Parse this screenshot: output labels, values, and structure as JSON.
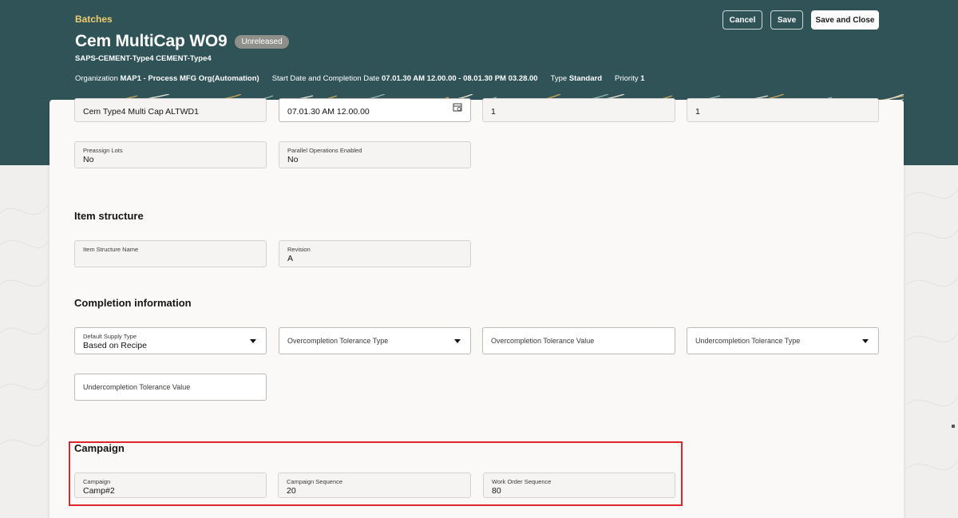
{
  "header": {
    "breadcrumb": "Batches",
    "title": "Cem MultiCap WO9",
    "status": "Unreleased",
    "subtitle": "SAPS-CEMENT-Type4 CEMENT-Type4",
    "meta": [
      {
        "label": "Organization",
        "value": "MAP1 - Process MFG Org(Automation)"
      },
      {
        "label": "Start Date and Completion Date",
        "value": "07.01.30 AM 12.00.00 - 08.01.30 PM 03.28.00"
      },
      {
        "label": "Type",
        "value": "Standard"
      },
      {
        "label": "Priority",
        "value": "1"
      }
    ],
    "buttons": {
      "cancel": "Cancel",
      "save": "Save",
      "save_close": "Save and Close"
    }
  },
  "top_fields": [
    {
      "value": "Cem Type4 Multi Cap ALTWD1"
    },
    {
      "value": "07.01.30 AM 12.00.00",
      "icon": "calendar-icon"
    },
    {
      "value": "1"
    },
    {
      "value": "1"
    }
  ],
  "general": {
    "preassign_lots": {
      "label": "Preassign Lots",
      "value": "No"
    },
    "parallel_ops": {
      "label": "Parallel Operations Enabled",
      "value": "No"
    }
  },
  "item_structure": {
    "title": "Item structure",
    "name": {
      "label": "Item Structure Name",
      "value": ""
    },
    "revision": {
      "label": "Revision",
      "value": "A"
    }
  },
  "completion": {
    "title": "Completion information",
    "supply_type": {
      "label": "Default Supply Type",
      "value": "Based on Recipe"
    },
    "overcompletion_type": {
      "placeholder": "Overcompletion Tolerance Type"
    },
    "overcompletion_value": {
      "placeholder": "Overcompletion Tolerance Value"
    },
    "undercompletion_type": {
      "placeholder": "Undercompletion Tolerance Type"
    },
    "undercompletion_value": {
      "placeholder": "Undercompletion Tolerance Value"
    }
  },
  "campaign": {
    "title": "Campaign",
    "campaign": {
      "label": "Campaign",
      "value": "Camp#2"
    },
    "sequence": {
      "label": "Campaign Sequence",
      "value": "20"
    },
    "wo_sequence": {
      "label": "Work Order Sequence",
      "value": "80"
    }
  },
  "colors": {
    "header_bg": "#2f5357",
    "breadcrumb": "#f0cc71",
    "highlight": "#e0262b"
  }
}
